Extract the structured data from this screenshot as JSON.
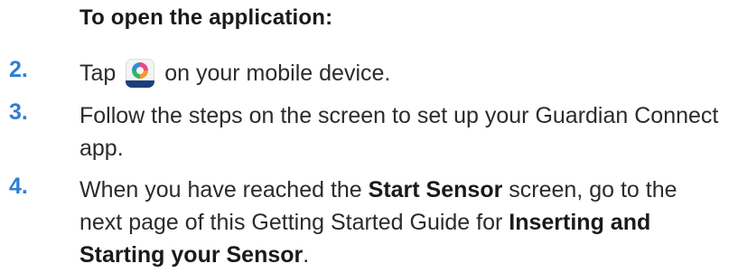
{
  "heading": "To open the application:",
  "steps": [
    {
      "number": "2.",
      "before_icon": "Tap ",
      "icon": "guardian-connect-app-icon",
      "after_icon": " on your mobile device."
    },
    {
      "number": "3.",
      "text": "Follow the steps on the screen to set up your Guardian Connect app."
    },
    {
      "number": "4.",
      "text_1": "When you have reached the ",
      "bold_1": "Start Sensor",
      "text_2": " screen, go to the next page of this Getting Started Guide for ",
      "bold_2": "Inserting and Starting your Sensor",
      "text_3": "."
    }
  ],
  "colors": {
    "step_number": "#2f7fd0",
    "text": "#2b2b2b",
    "icon_footer": "#1c3f7a"
  }
}
